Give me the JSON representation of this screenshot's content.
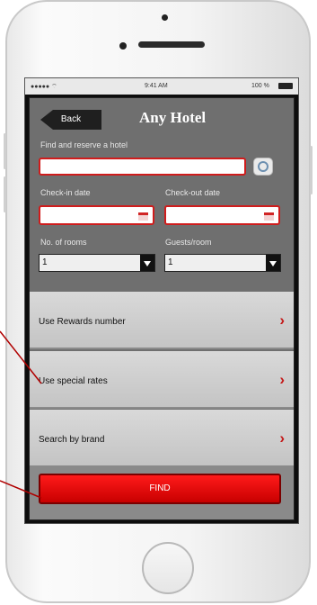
{
  "status_bar": {
    "carrier": "●●●●● ⌔",
    "time": "9:41 AM",
    "battery": "100 %"
  },
  "header": {
    "back_label": "Back",
    "title": "Any Hotel"
  },
  "search": {
    "label": "Find and reserve a hotel",
    "value": "",
    "checkin_label": "Check-in date",
    "checkout_label": "Check-out date",
    "rooms_label": "No. of rooms",
    "guests_label": "Guests/room",
    "rooms_value": "1",
    "guests_value": "1"
  },
  "options": [
    {
      "label": "Use Rewards number"
    },
    {
      "label": "Use special rates"
    },
    {
      "label": "Search by brand"
    }
  ],
  "find_label": "FIND",
  "colors": {
    "accent": "#d10000",
    "panel": "#6f6f6f",
    "row": "#cfcfcf"
  },
  "icons": [
    "back-arrow-icon",
    "help-icon",
    "calendar-icon",
    "dropdown-arrow-icon",
    "chevron-right-icon",
    "callout-line"
  ]
}
